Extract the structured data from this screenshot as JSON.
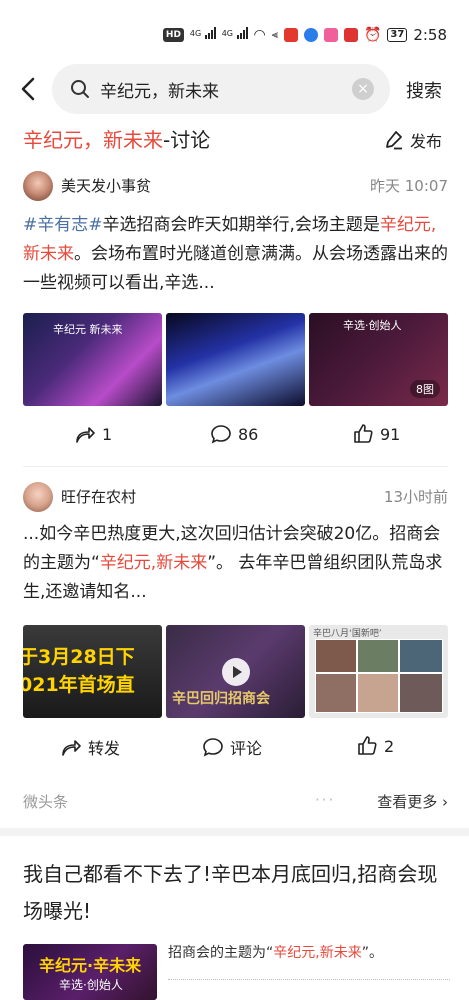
{
  "status_bar": {
    "hd_label": "HD",
    "battery": "37",
    "time": "2:58",
    "sim1_label": "4G",
    "sim2_label": "4G"
  },
  "search": {
    "query": "辛纪元，新未来",
    "search_button": "搜索"
  },
  "topic": {
    "highlight": "辛纪元，新未来",
    "suffix": "-讨论",
    "publish_label": "发布"
  },
  "posts": [
    {
      "author": "美天发小事贫",
      "time": "昨天 10:07",
      "hashtag": "#辛有志#",
      "text_before": "辛选招商会昨天如期举行,会场主题是",
      "text_red": "辛纪元,新未来",
      "text_after": "。会场布置时光隧道创意满满。从会场透露出来的一些视频可以看出,辛选...",
      "images": [
        {
          "caption": "辛纪元  新未来"
        },
        {
          "caption": ""
        },
        {
          "caption": "辛选·创始人"
        }
      ],
      "image_count": "8图",
      "share_count": "1",
      "comment_count": "86",
      "like_count": "91"
    },
    {
      "author": "旺仔在农村",
      "time": "13小时前",
      "text_before": "...如今辛巴热度更大,这次回归估计会突破20亿。招商会的主题为“",
      "text_red": "辛纪元,新未来",
      "text_after": "”。 去年辛巴曾组织团队荒岛求生,还邀请知名...",
      "images": [
        {
          "caption": "于3月28日下 021年首场直"
        },
        {
          "caption": "辛巴回归招商会"
        },
        {
          "caption": "辛巴八月‘国新吧’"
        }
      ],
      "share_label": "转发",
      "comment_label": "评论",
      "like_count": "2"
    }
  ],
  "feed_footer": {
    "source": "微头条",
    "dots": "···",
    "more": "查看更多 ›"
  },
  "article": {
    "title": "我自己都看不下去了!辛巴本月底回归,招商会现场曝光!",
    "snippet_before": "招商会的主题为“",
    "snippet_red": "辛纪元,新未来",
    "snippet_after": "”。",
    "thumb_caption_1": "辛纪元·辛未来",
    "thumb_caption_2": "辛选·创始人"
  },
  "colors": {
    "accent_red": "#e74a3c",
    "hashtag_blue": "#4a6fa5",
    "thumbnail_yellow": "#ffd400"
  }
}
